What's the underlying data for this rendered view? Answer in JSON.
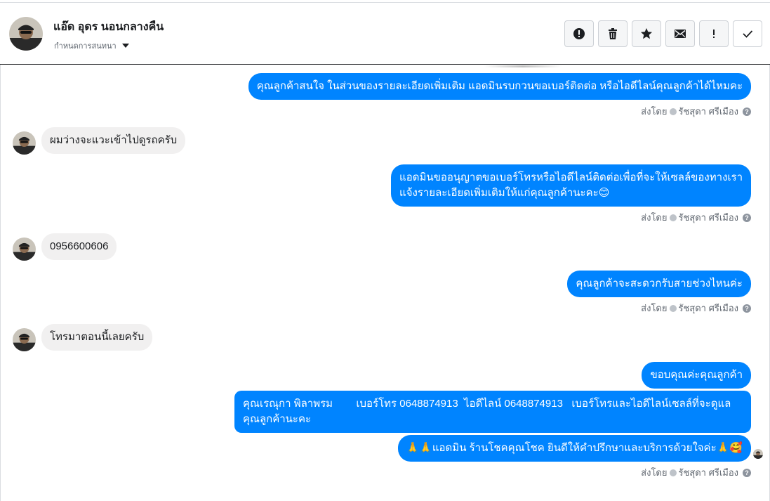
{
  "header": {
    "name": "แอ๊ด อุดร นอนกลางคืน",
    "subtitle": "กำหนดการสนทนา",
    "actions": [
      {
        "name": "report-button",
        "icon": "alert-circle-icon"
      },
      {
        "name": "delete-button",
        "icon": "trash-icon"
      },
      {
        "name": "star-button",
        "icon": "star-icon"
      },
      {
        "name": "mark-unread-button",
        "icon": "envelope-icon"
      },
      {
        "name": "important-button",
        "icon": "exclamation-icon"
      },
      {
        "name": "done-button",
        "icon": "check-icon"
      }
    ]
  },
  "messages": {
    "m1": "คุณลูกค้าสนใจ ในส่วนของรายละเอียดเพิ่มเติม แอดมินรบกวนขอเบอร์ติดต่อ หรือไอดีไลน์คุณลูกค้าได้ไหมคะ",
    "m2": "ผมว่างจะแวะเข้าไปดูรถครับ",
    "m3_line1": "แอดมินขออนุญาตขอเบอร์โทรหรือไอดีไลน์ติดต่อเพื่อที่จะให้เซลล์ของทางเรา",
    "m3_line2": "แจ้งรายละเอียดเพิ่มเติมให้แก่คุณลูกค้านะคะ😊",
    "m4": "0956600606",
    "m5": "คุณลูกค้าจะสะดวกรับสายช่วงไหนค่ะ",
    "m6": "โทรมาตอนนี้เลยครับ",
    "m7": "ขอบคุณค่ะคุณลูกค้า",
    "m8_line1": "คุณเรณุกา พิลาพรม        เบอร์โทร 0648874913  ไอดีไลน์ 0648874913   เบอร์โทรและไอดีไลน์เซลล์ที่จะดูแล",
    "m8_line2": "คุณลูกค้านะคะ",
    "m9": "🙏🙏แอดมิน ร้านโชคคุณโชค ยินดีให้คำปรึกษาและบริการด้วยใจค่ะ🙏🥰"
  },
  "sent_by": {
    "prefix": "ส่งโดย",
    "agent": "รัชสุดา ศรีเมือง"
  },
  "colors": {
    "outgoing_bubble": "#0084ff",
    "incoming_bubble": "#f1f0f0"
  }
}
